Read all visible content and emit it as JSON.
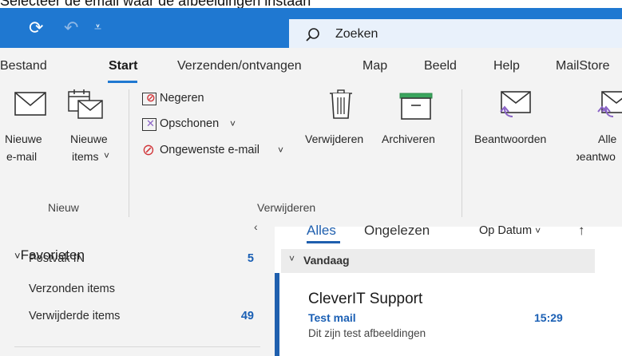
{
  "caption": "Selecteer de email waar de afbeeldingen instaan",
  "titlebar": {
    "search_placeholder": "Zoeken"
  },
  "tabs": [
    {
      "label": "Bestand"
    },
    {
      "label": "Start"
    },
    {
      "label": "Verzenden/ontvangen"
    },
    {
      "label": "Map"
    },
    {
      "label": "Beeld"
    },
    {
      "label": "Help"
    },
    {
      "label": "MailStore"
    }
  ],
  "ribbon": {
    "new_group": {
      "new_email_line1": "Nieuwe",
      "new_email_line2": "e-mail",
      "new_items_line1": "Nieuwe",
      "new_items_line2": "items",
      "label": "Nieuw"
    },
    "delete_group": {
      "ignore": "Negeren",
      "cleanup": "Opschonen",
      "junk": "Ongewenste e-mail",
      "delete": "Verwijderen",
      "archive": "Archiveren",
      "label": "Verwijderen"
    },
    "respond_group": {
      "reply": "Beantwoorden",
      "reply_all_line1": "Alle",
      "reply_all_line2": "beantwo"
    }
  },
  "folders": {
    "favorites_label": "Favorieten",
    "items": [
      {
        "name": "Postvak IN",
        "count": "5"
      },
      {
        "name": "Verzonden items",
        "count": ""
      },
      {
        "name": "Verwijderde items",
        "count": "49"
      }
    ]
  },
  "mail_list": {
    "filter_all": "Alles",
    "filter_unread": "Ongelezen",
    "sort_label": "Op Datum",
    "group_label": "Vandaag",
    "items": [
      {
        "sender": "CleverIT Support",
        "subject": "Test mail",
        "time": "15:29",
        "preview": "Dit zijn test afbeeldingen"
      }
    ]
  },
  "colors": {
    "accent": "#1f78d1",
    "unread_blue": "#1a5fb4",
    "reply_purple": "#8a63c6"
  }
}
